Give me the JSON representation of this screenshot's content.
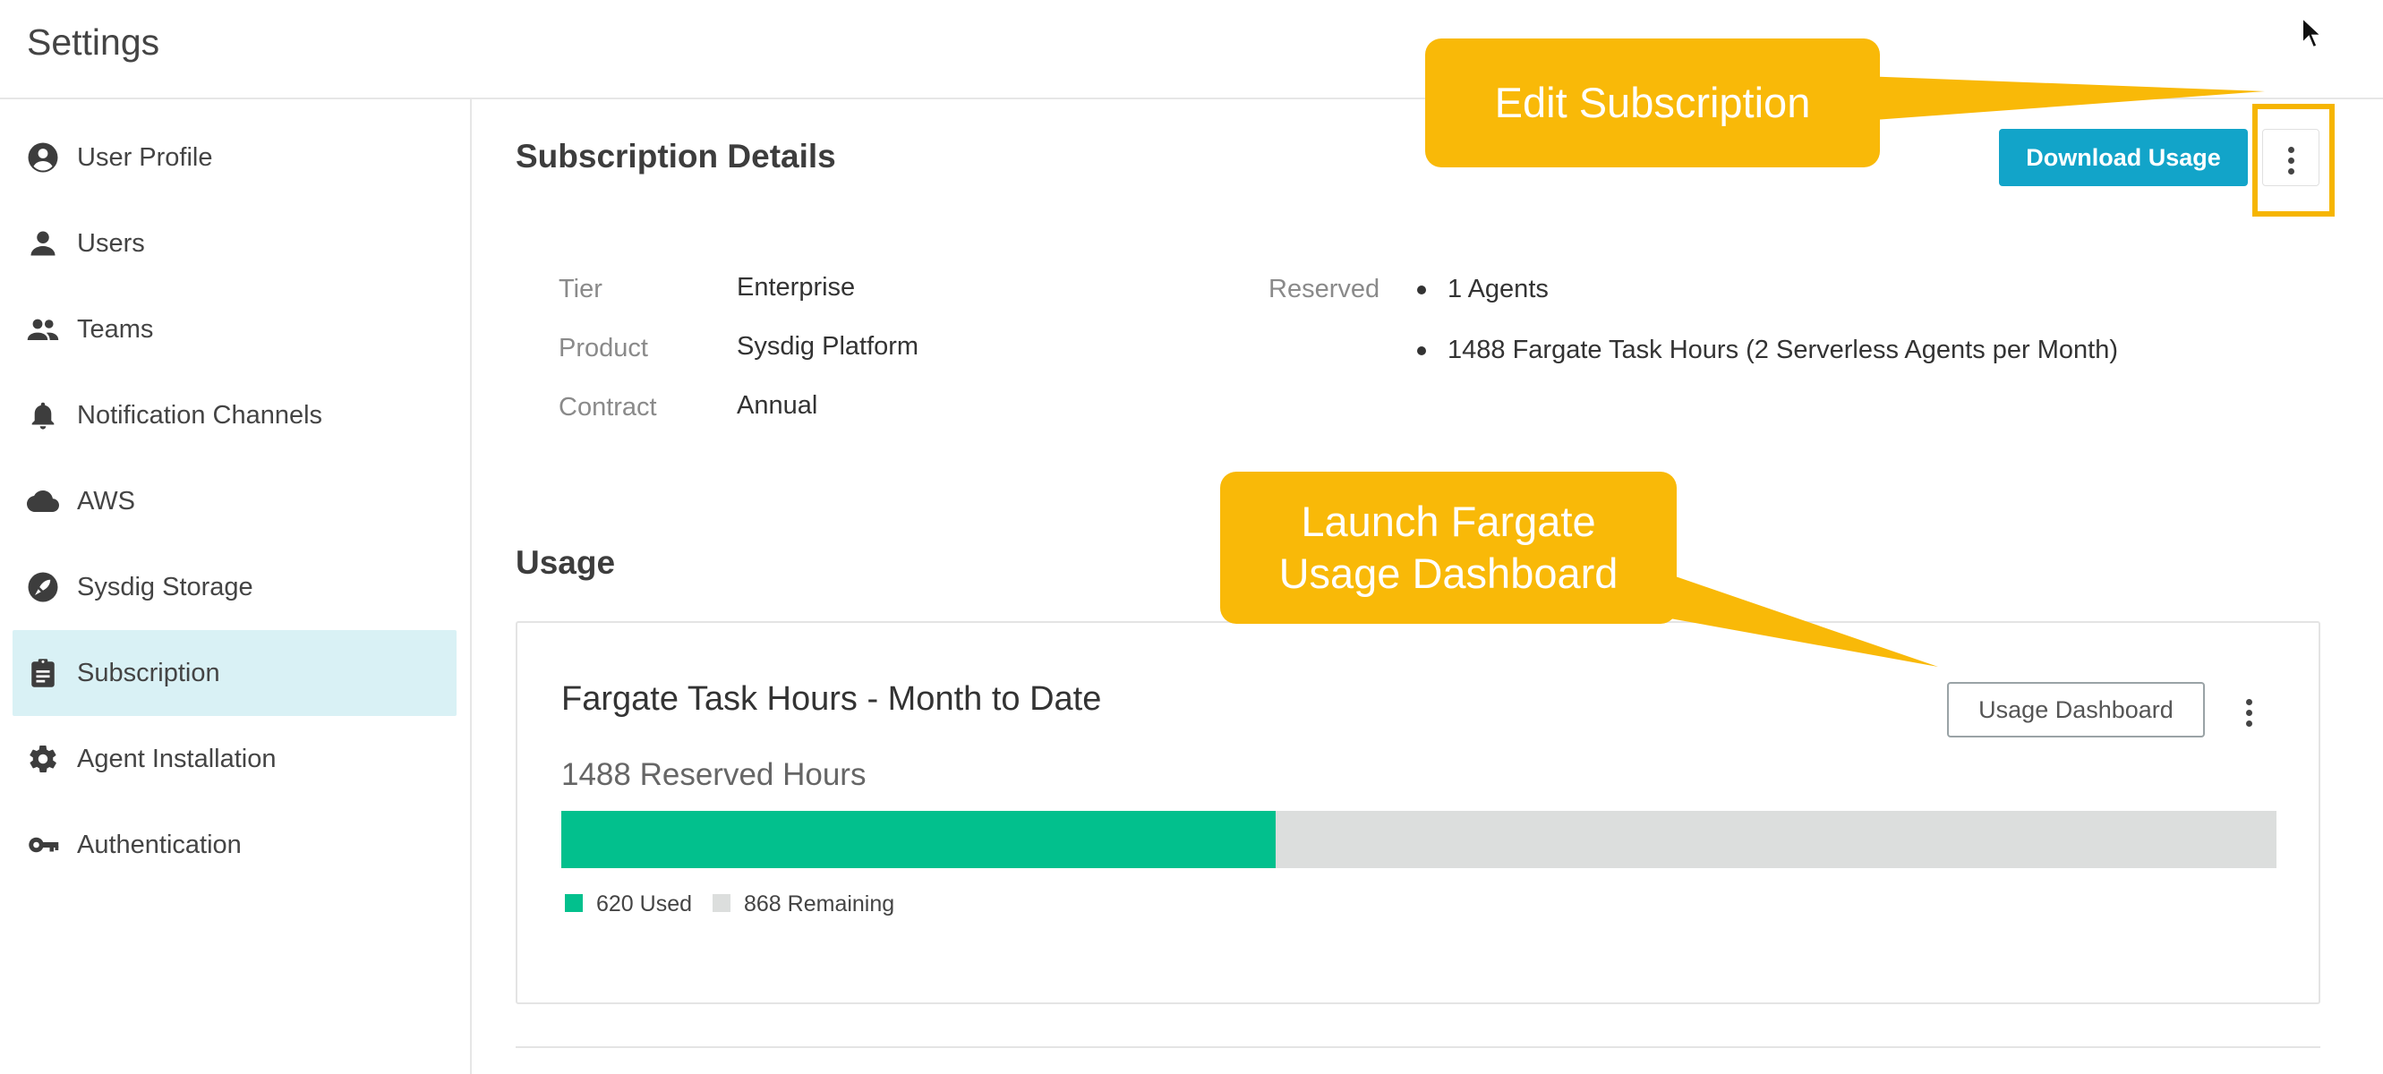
{
  "header": {
    "title": "Settings"
  },
  "sidebar": {
    "items": [
      {
        "label": "User Profile",
        "icon": "account-circle-icon",
        "active": false
      },
      {
        "label": "Users",
        "icon": "person-icon",
        "active": false
      },
      {
        "label": "Teams",
        "icon": "people-icon",
        "active": false
      },
      {
        "label": "Notification Channels",
        "icon": "bell-icon",
        "active": false
      },
      {
        "label": "AWS",
        "icon": "cloud-icon",
        "active": false
      },
      {
        "label": "Sysdig Storage",
        "icon": "rocket-icon",
        "active": false
      },
      {
        "label": "Subscription",
        "icon": "clipboard-icon",
        "active": true
      },
      {
        "label": "Agent Installation",
        "icon": "gear-icon",
        "active": false
      },
      {
        "label": "Authentication",
        "icon": "key-icon",
        "active": false
      }
    ]
  },
  "subscription": {
    "title": "Subscription Details",
    "download_label": "Download Usage",
    "details": [
      {
        "label": "Tier",
        "value": "Enterprise"
      },
      {
        "label": "Product",
        "value": "Sysdig Platform"
      },
      {
        "label": "Contract",
        "value": "Annual"
      }
    ],
    "reserved_label": "Reserved",
    "reserved_items": [
      "1 Agents",
      "1488 Fargate Task Hours (2 Serverless Agents per Month)"
    ]
  },
  "usage": {
    "title": "Usage",
    "card": {
      "title": "Fargate Task Hours - Month to Date",
      "reserved_text": "1488 Reserved Hours",
      "dashboard_button": "Usage Dashboard",
      "used": 620,
      "remaining": 868,
      "used_label": "620 Used",
      "remaining_label": "868 Remaining"
    }
  },
  "callouts": {
    "edit": "Edit Subscription",
    "launch_line1": "Launch Fargate",
    "launch_line2": "Usage Dashboard"
  },
  "colors": {
    "accent": "#12a4c9",
    "used": "#02c08d",
    "remaining": "#dcdedd",
    "callout": "#f9b908",
    "active_nav": "#d9f1f5"
  }
}
